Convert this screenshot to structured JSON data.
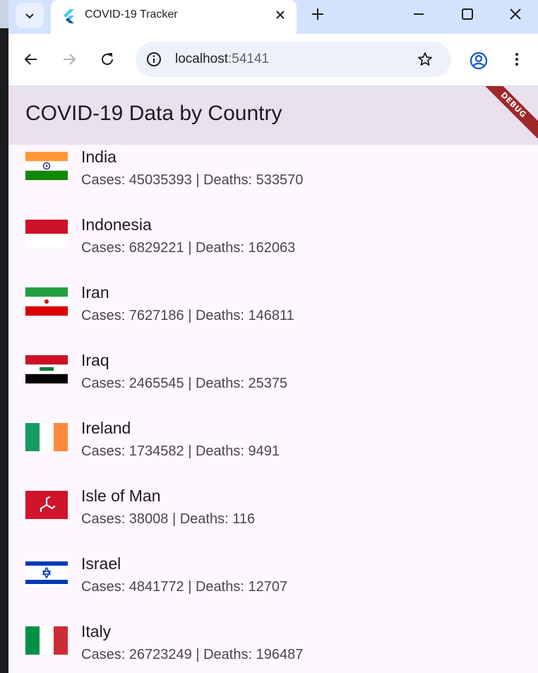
{
  "browser": {
    "tab_title": "COVID-19 Tracker",
    "url_host": "localhost",
    "url_port": ":54141"
  },
  "app": {
    "title": "COVID-19 Data by Country",
    "debug_banner": "DEBUG"
  },
  "countries": [
    {
      "name": "India",
      "stats": "Cases: 45035393 | Deaths: 533570"
    },
    {
      "name": "Indonesia",
      "stats": "Cases: 6829221 | Deaths: 162063"
    },
    {
      "name": "Iran",
      "stats": "Cases: 7627186 | Deaths: 146811"
    },
    {
      "name": "Iraq",
      "stats": "Cases: 2465545 | Deaths: 25375"
    },
    {
      "name": "Ireland",
      "stats": "Cases: 1734582 | Deaths: 9491"
    },
    {
      "name": "Isle of Man",
      "stats": "Cases: 38008 | Deaths: 116"
    },
    {
      "name": "Israel",
      "stats": "Cases: 4841772 | Deaths: 12707"
    },
    {
      "name": "Italy",
      "stats": "Cases: 26723249 | Deaths: 196487"
    }
  ],
  "colors": {
    "appbar": "#e9e1ee",
    "background": "#fef7ff",
    "tabstrip": "#d3e3fd",
    "debug": "#a0272a"
  }
}
